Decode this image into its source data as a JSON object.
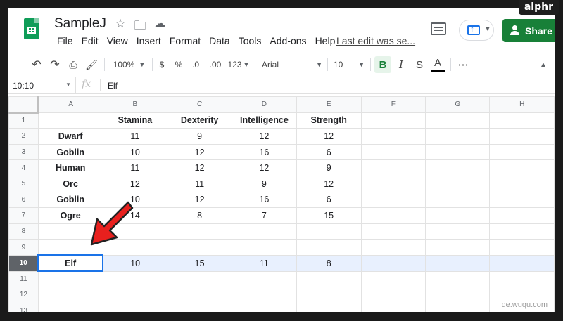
{
  "watermark": {
    "brand": "alphr",
    "site": "de.wuqu.com"
  },
  "header": {
    "doc_title": "SampleJ",
    "menu": [
      "File",
      "Edit",
      "View",
      "Insert",
      "Format",
      "Data",
      "Tools",
      "Add-ons",
      "Help"
    ],
    "last_edit": "Last edit was se...",
    "share_label": "Share",
    "icons": [
      "star-icon",
      "folder-icon",
      "cloud-icon",
      "comment-icon",
      "present-icon",
      "person-add-icon"
    ]
  },
  "toolbar": {
    "zoom": "100%",
    "currency": "$",
    "percent": "%",
    "dec_decrease": ".0",
    "dec_increase": ".00",
    "more_formats": "123",
    "font": "Arial",
    "font_size": "10",
    "bold": "B",
    "italic": "I",
    "strike": "S",
    "text_color": "A",
    "more": "⋯"
  },
  "formula_bar": {
    "cell_ref": "10:10",
    "fx": "fx",
    "value": "Elf"
  },
  "columns": [
    "A",
    "B",
    "C",
    "D",
    "E",
    "F",
    "G",
    "H"
  ],
  "rows": [
    {
      "num": "1",
      "cells": [
        "",
        "Stamina",
        "Dexterity",
        "Intelligence",
        "Strength",
        "",
        "",
        ""
      ]
    },
    {
      "num": "2",
      "cells": [
        "Dwarf",
        "11",
        "9",
        "12",
        "12",
        "",
        "",
        ""
      ]
    },
    {
      "num": "3",
      "cells": [
        "Goblin",
        "10",
        "12",
        "16",
        "6",
        "",
        "",
        ""
      ]
    },
    {
      "num": "4",
      "cells": [
        "Human",
        "11",
        "12",
        "12",
        "9",
        "",
        "",
        ""
      ]
    },
    {
      "num": "5",
      "cells": [
        "Orc",
        "12",
        "11",
        "9",
        "12",
        "",
        "",
        ""
      ]
    },
    {
      "num": "6",
      "cells": [
        "Goblin",
        "10",
        "12",
        "16",
        "6",
        "",
        "",
        ""
      ]
    },
    {
      "num": "7",
      "cells": [
        "Ogre",
        "14",
        "8",
        "7",
        "15",
        "",
        "",
        ""
      ]
    },
    {
      "num": "8",
      "cells": [
        "",
        "",
        "",
        "",
        "",
        "",
        "",
        ""
      ]
    },
    {
      "num": "9",
      "cells": [
        "",
        "",
        "",
        "",
        "",
        "",
        "",
        ""
      ]
    },
    {
      "num": "10",
      "cells": [
        "Elf",
        "10",
        "15",
        "11",
        "8",
        "",
        "",
        ""
      ],
      "selected": true
    },
    {
      "num": "11",
      "cells": [
        "",
        "",
        "",
        "",
        "",
        "",
        "",
        ""
      ]
    },
    {
      "num": "12",
      "cells": [
        "",
        "",
        "",
        "",
        "",
        "",
        "",
        ""
      ]
    },
    {
      "num": "13",
      "cells": [
        "",
        "",
        "",
        "",
        "",
        "",
        "",
        ""
      ]
    }
  ],
  "colors": {
    "brand_green": "#188038",
    "selection": "#e8f0fe",
    "active_border": "#1a73e8",
    "arrow": "#e8201e"
  }
}
